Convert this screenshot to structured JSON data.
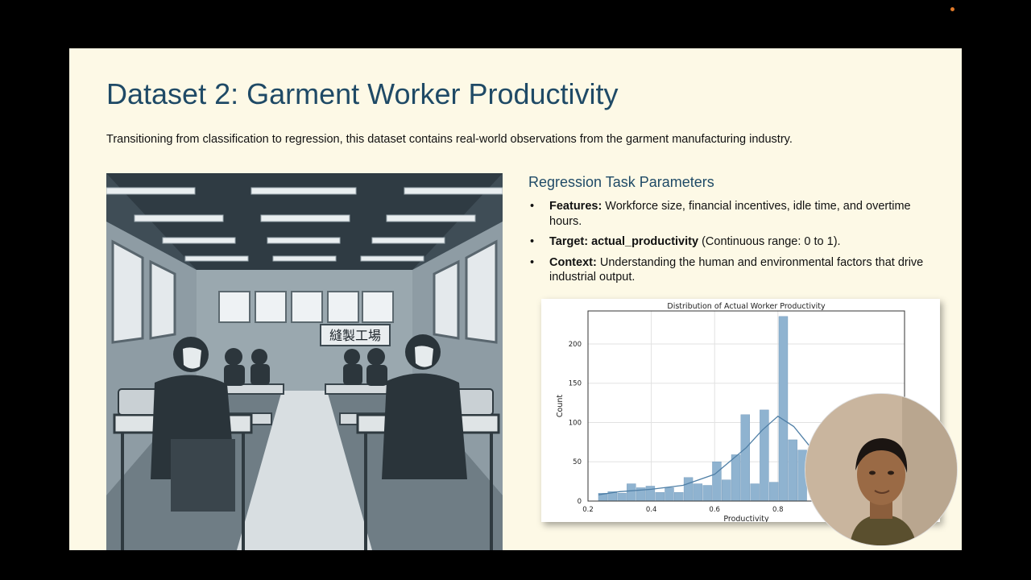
{
  "slide": {
    "title": "Dataset 2: Garment Worker Productivity",
    "subtitle": "Transitioning from classification to regression, this dataset contains real-world observations from the garment manufacturing industry.",
    "illustration_sign": "縫製工場",
    "section_title": "Regression Task Parameters",
    "bullets": [
      {
        "bold": "Features:",
        "text": " Workforce size, financial incentives, idle time, and overtime hours."
      },
      {
        "bold": "Target: actual_productivity",
        "text": " (Continuous range: 0 to 1)."
      },
      {
        "bold": "Context:",
        "text": " Understanding the human and environmental factors that drive industrial output."
      }
    ]
  },
  "chart_data": {
    "type": "bar",
    "title": "Distribution of Actual Worker Productivity",
    "xlabel": "Productivity",
    "ylabel": "Count",
    "xticks": [
      "0.2",
      "0.4",
      "0.6",
      "0.8"
    ],
    "yticks": [
      "0",
      "50",
      "100",
      "150",
      "200"
    ],
    "xlim": [
      0.2,
      1.2
    ],
    "ylim": [
      0,
      242
    ],
    "grid": true,
    "bin_width": 0.03,
    "bin_starts": [
      0.233,
      0.263,
      0.293,
      0.323,
      0.353,
      0.383,
      0.413,
      0.443,
      0.473,
      0.503,
      0.533,
      0.563,
      0.593,
      0.623,
      0.653,
      0.683,
      0.713,
      0.743,
      0.773,
      0.803,
      0.833,
      0.863
    ],
    "values": [
      10,
      12,
      10,
      22,
      17,
      19,
      11,
      17,
      11,
      30,
      22,
      20,
      50,
      27,
      59,
      110,
      22,
      116,
      24,
      235,
      78,
      65
    ],
    "kde_curve": [
      [
        0.233,
        8
      ],
      [
        0.3,
        12
      ],
      [
        0.4,
        15
      ],
      [
        0.5,
        20
      ],
      [
        0.6,
        34
      ],
      [
        0.7,
        68
      ],
      [
        0.75,
        90
      ],
      [
        0.8,
        108
      ],
      [
        0.85,
        95
      ],
      [
        0.9,
        70
      ]
    ],
    "bar_color": "#8fb3d0",
    "kde_color": "#4f7fa6"
  }
}
